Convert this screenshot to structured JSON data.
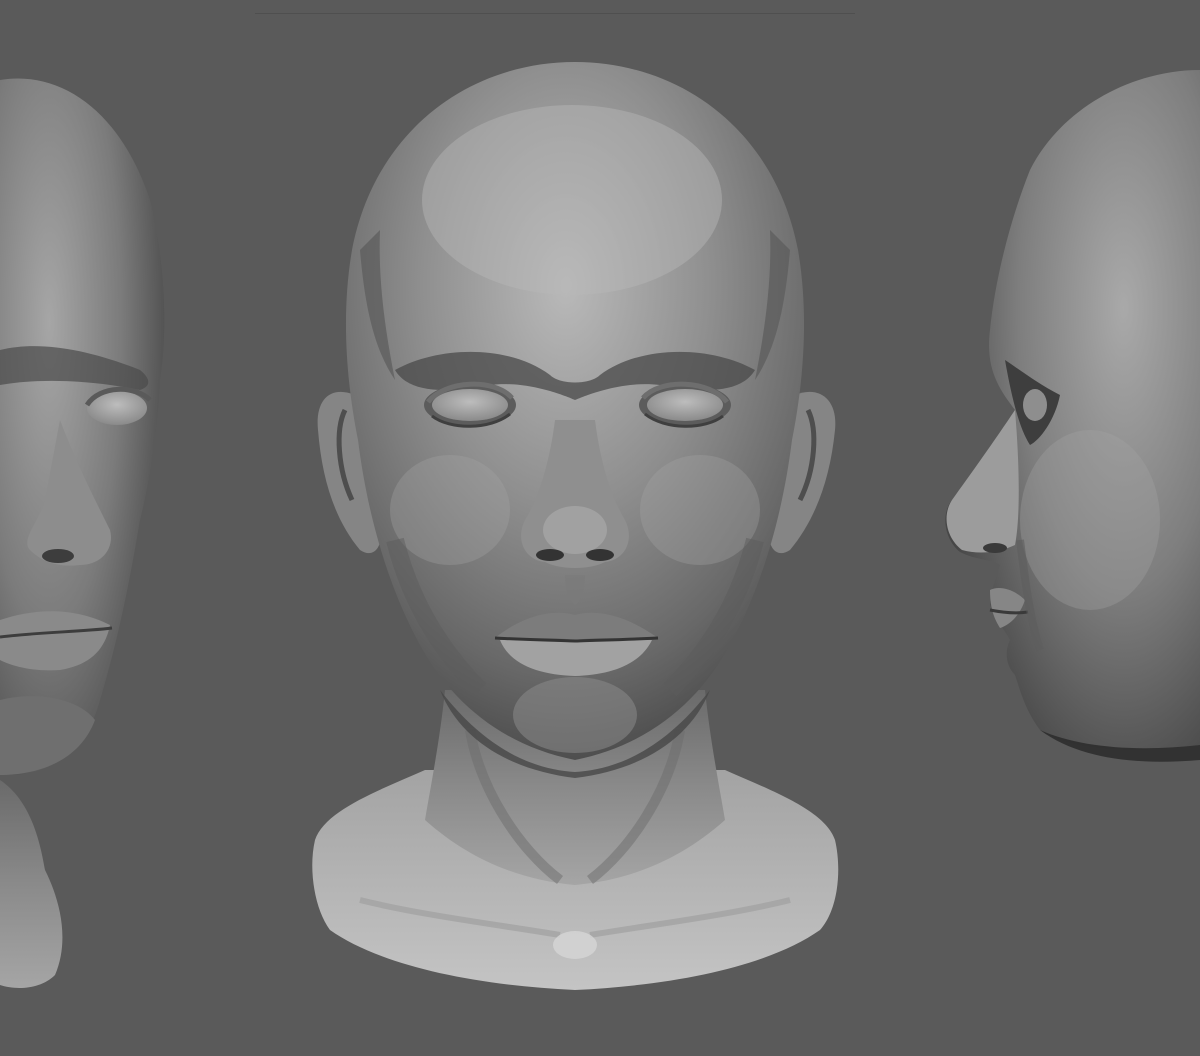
{
  "scene": {
    "background_color": "#5a5a5a",
    "sculpt_material": "clay-gray",
    "views": [
      {
        "id": "three-quarter-left",
        "cropped": true
      },
      {
        "id": "front",
        "cropped": false
      },
      {
        "id": "profile-right",
        "cropped": true
      }
    ]
  },
  "colors": {
    "clay_light": "#c9c9c9",
    "clay_mid": "#8e8e8e",
    "clay_dark": "#3f3f3f",
    "shadow": "#2e2e2e"
  }
}
